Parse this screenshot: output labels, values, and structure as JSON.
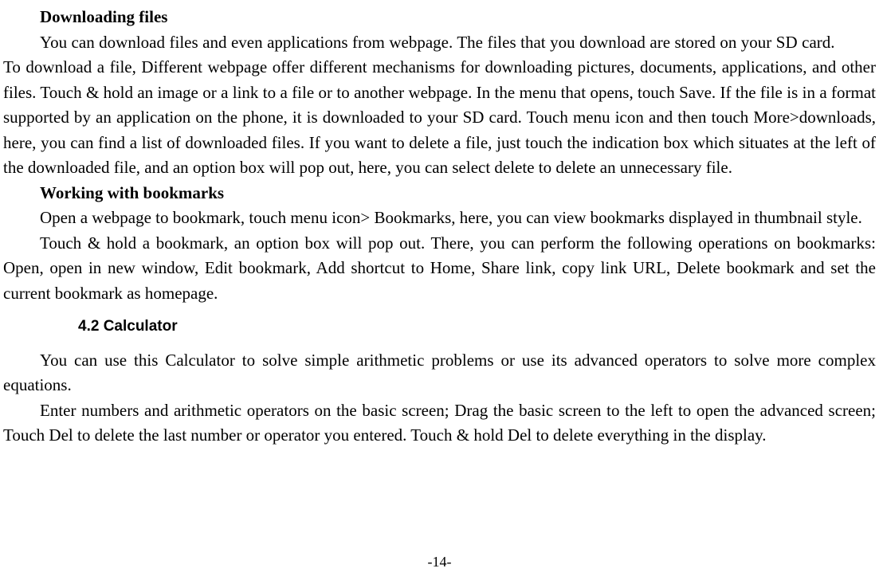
{
  "headings": {
    "downloading": "Downloading files",
    "bookmarks": "Working with bookmarks",
    "calculator_section": "4.2    Calculator"
  },
  "paragraphs": {
    "download_intro": "You can download files and even applications from webpage. The files that you download are stored on your SD card.",
    "download_detail": "To download a file, Different webpage offer different mechanisms for downloading pictures, documents, applications, and other files. Touch & hold an image or a link to a file or to another webpage. In the menu that opens, touch Save. If the file is in a format supported by an application on the phone, it is downloaded to your SD card. Touch menu icon and then touch More>downloads, here, you can find a list of downloaded files. If you want to delete a file, just touch the indication box which situates at the left of the downloaded file, and an option box will pop out, here, you can select delete to delete an unnecessary file.",
    "bookmarks_intro": "Open a webpage to bookmark, touch menu icon> Bookmarks, here, you can view bookmarks displayed in thumbnail style.",
    "bookmarks_detail": "Touch & hold a bookmark, an option box will pop out. There, you can perform the following operations on bookmarks: Open, open in new window, Edit bookmark, Add shortcut to Home, Share link, copy link URL, Delete bookmark and set the current bookmark as homepage.",
    "calculator_intro": "You can use this Calculator to solve simple arithmetic problems or use its advanced operators to solve more complex equations.",
    "calculator_detail": "Enter numbers and arithmetic operators on the basic screen; Drag the basic screen to the left to open the advanced screen; Touch Del to delete the last number or operator you entered. Touch & hold Del to delete everything in the display."
  },
  "page_number": "-14-"
}
